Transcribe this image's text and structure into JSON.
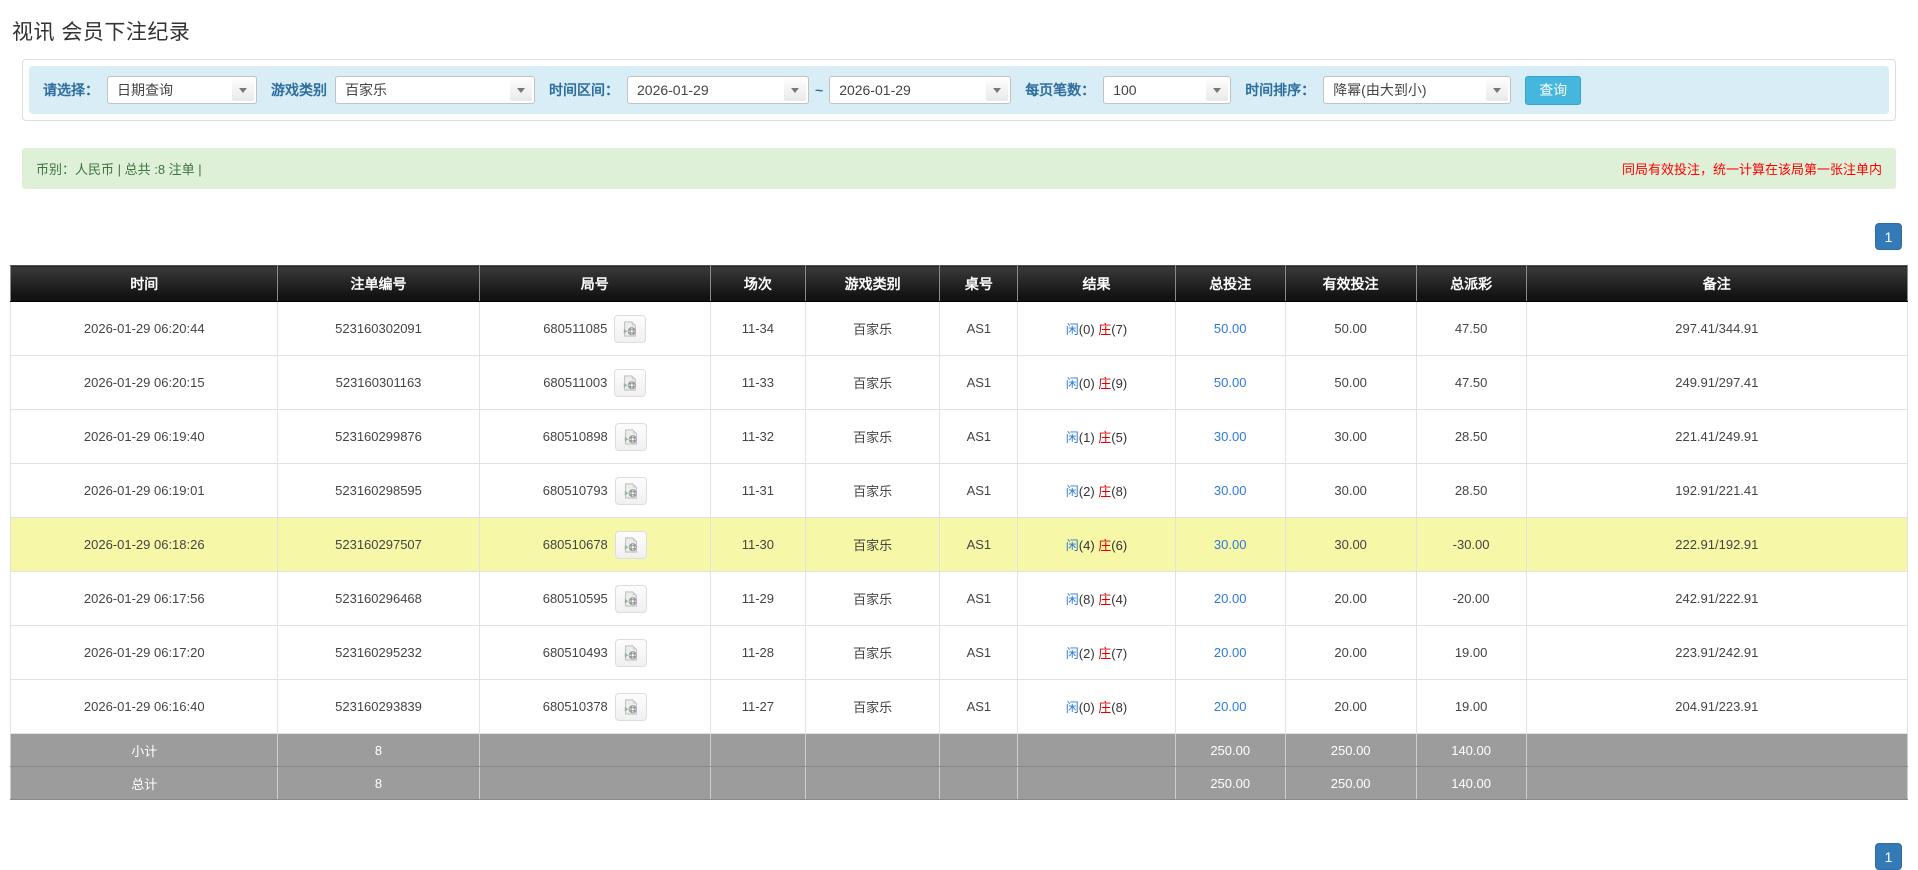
{
  "page": {
    "title": "视讯 会员下注纪录"
  },
  "filters": {
    "select_label": "请选择：",
    "select_value": "日期查询",
    "game_type_label": "游戏类别",
    "game_type_value": "百家乐",
    "time_range_label": "时间区间：",
    "time_from": "2026-01-29",
    "time_separator": "~",
    "time_to": "2026-01-29",
    "per_page_label": "每页笔数：",
    "per_page_value": "100",
    "sort_label": "时间排序：",
    "sort_value": "降幂(由大到小)",
    "search_button": "查询"
  },
  "summary": {
    "left_text": "币别：人民币 | 总共 :8 注单 |",
    "right_notice": "同局有效投注，统一计算在该局第一张注单内"
  },
  "pagination": {
    "page": "1"
  },
  "colors": {
    "accent_blue": "#337ab7",
    "link_blue": "#2d7bd9",
    "banker_red": "#e00000",
    "negative_red": "#ff0000",
    "highlight_yellow": "#f7f7a8",
    "summary_green_bg": "#dff0d8",
    "filter_blue_bg": "#d9edf7"
  },
  "table": {
    "headers": [
      "时间",
      "注单编号",
      "局号",
      "场次",
      "游戏类别",
      "桌号",
      "结果",
      "总投注",
      "有效投注",
      "总派彩",
      "备注"
    ],
    "col_widths_pct": [
      14.1,
      10.6,
      12.2,
      5.0,
      7.1,
      4.1,
      8.3,
      5.8,
      6.9,
      5.8,
      20.1
    ],
    "rows": [
      {
        "time": "2026-01-29 06:20:44",
        "bet_id": "523160302091",
        "round_id": "680511085",
        "session": "11-34",
        "game": "百家乐",
        "table_no": "AS1",
        "player_label": "闲",
        "player_num": "(0)",
        "banker_label": "庄",
        "banker_num": "(7)",
        "total_bet": "50.00",
        "valid_bet": "50.00",
        "payout": "47.50",
        "remark": "297.41/344.91",
        "highlight": false
      },
      {
        "time": "2026-01-29 06:20:15",
        "bet_id": "523160301163",
        "round_id": "680511003",
        "session": "11-33",
        "game": "百家乐",
        "table_no": "AS1",
        "player_label": "闲",
        "player_num": "(0)",
        "banker_label": "庄",
        "banker_num": "(9)",
        "total_bet": "50.00",
        "valid_bet": "50.00",
        "payout": "47.50",
        "remark": "249.91/297.41",
        "highlight": false
      },
      {
        "time": "2026-01-29 06:19:40",
        "bet_id": "523160299876",
        "round_id": "680510898",
        "session": "11-32",
        "game": "百家乐",
        "table_no": "AS1",
        "player_label": "闲",
        "player_num": "(1)",
        "banker_label": "庄",
        "banker_num": "(5)",
        "total_bet": "30.00",
        "valid_bet": "30.00",
        "payout": "28.50",
        "remark": "221.41/249.91",
        "highlight": false
      },
      {
        "time": "2026-01-29 06:19:01",
        "bet_id": "523160298595",
        "round_id": "680510793",
        "session": "11-31",
        "game": "百家乐",
        "table_no": "AS1",
        "player_label": "闲",
        "player_num": "(2)",
        "banker_label": "庄",
        "banker_num": "(8)",
        "total_bet": "30.00",
        "valid_bet": "30.00",
        "payout": "28.50",
        "remark": "192.91/221.41",
        "highlight": false
      },
      {
        "time": "2026-01-29 06:18:26",
        "bet_id": "523160297507",
        "round_id": "680510678",
        "session": "11-30",
        "game": "百家乐",
        "table_no": "AS1",
        "player_label": "闲",
        "player_num": "(4)",
        "banker_label": "庄",
        "banker_num": "(6)",
        "total_bet": "30.00",
        "valid_bet": "30.00",
        "payout": "-30.00",
        "remark": "222.91/192.91",
        "highlight": true
      },
      {
        "time": "2026-01-29 06:17:56",
        "bet_id": "523160296468",
        "round_id": "680510595",
        "session": "11-29",
        "game": "百家乐",
        "table_no": "AS1",
        "player_label": "闲",
        "player_num": "(8)",
        "banker_label": "庄",
        "banker_num": "(4)",
        "total_bet": "20.00",
        "valid_bet": "20.00",
        "payout": "-20.00",
        "remark": "242.91/222.91",
        "highlight": false
      },
      {
        "time": "2026-01-29 06:17:20",
        "bet_id": "523160295232",
        "round_id": "680510493",
        "session": "11-28",
        "game": "百家乐",
        "table_no": "AS1",
        "player_label": "闲",
        "player_num": "(2)",
        "banker_label": "庄",
        "banker_num": "(7)",
        "total_bet": "20.00",
        "valid_bet": "20.00",
        "payout": "19.00",
        "remark": "223.91/242.91",
        "highlight": false
      },
      {
        "time": "2026-01-29 06:16:40",
        "bet_id": "523160293839",
        "round_id": "680510378",
        "session": "11-27",
        "game": "百家乐",
        "table_no": "AS1",
        "player_label": "闲",
        "player_num": "(0)",
        "banker_label": "庄",
        "banker_num": "(8)",
        "total_bet": "20.00",
        "valid_bet": "20.00",
        "payout": "19.00",
        "remark": "204.91/223.91",
        "highlight": false
      }
    ],
    "subtotal": {
      "label": "小计",
      "count": "8",
      "total_bet": "250.00",
      "valid_bet": "250.00",
      "payout": "140.00"
    },
    "total": {
      "label": "总计",
      "count": "8",
      "total_bet": "250.00",
      "valid_bet": "250.00",
      "payout": "140.00"
    }
  }
}
